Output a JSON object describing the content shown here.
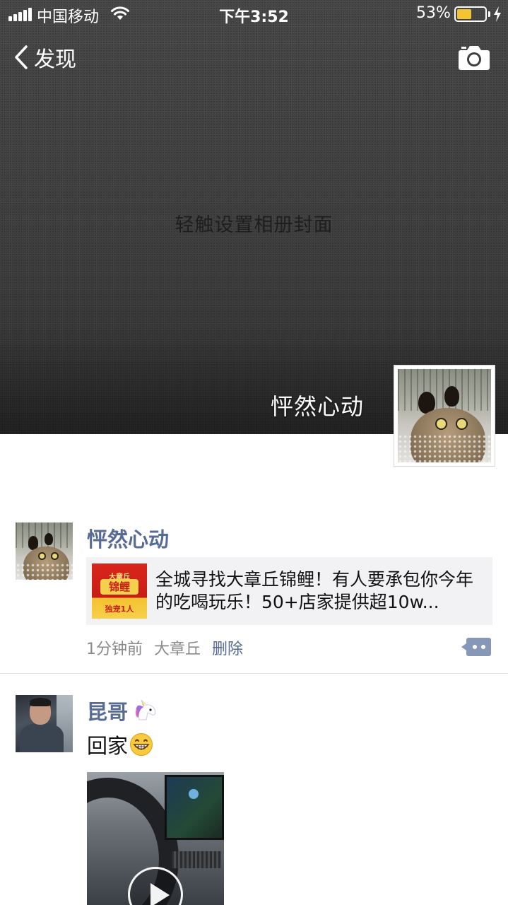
{
  "status_bar": {
    "carrier": "中国移动",
    "time": "下午3:52",
    "battery_percent": "53%",
    "battery_level": 0.53,
    "charging": true
  },
  "nav": {
    "back_label": "发现",
    "back_icon": "chevron-left-icon",
    "camera_icon": "camera-icon"
  },
  "cover": {
    "hint": "轻触设置相册封面"
  },
  "profile": {
    "name": "怦然心动"
  },
  "feed": [
    {
      "name": "怦然心动",
      "link": {
        "title": "全城寻找大章丘锦鲤！有人要承包你今年的吃喝玩乐！50+店家提供超10w...",
        "thumb_top": "大章丘",
        "thumb_mid": "锦鲤",
        "thumb_bottom": "独宠1人"
      },
      "time": "1分钟前",
      "location": "大章丘",
      "delete_label": "删除"
    },
    {
      "name": "昆哥",
      "name_emoji": "unicorn-icon",
      "text": "回家",
      "text_emoji": "grinning-face-icon",
      "media": "video"
    }
  ],
  "colors": {
    "link_blue": "#576b95",
    "cover_bg": "#3f3f3f",
    "battery_yellow": "#f5c433"
  }
}
